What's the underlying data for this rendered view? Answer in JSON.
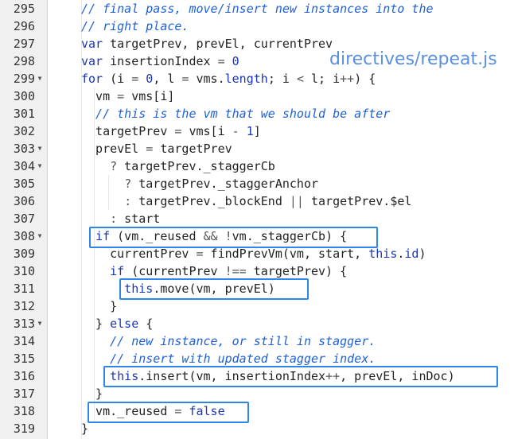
{
  "file_label": "directives/repeat.js",
  "colors": {
    "comment": "#1f5fd6",
    "keyword": "#1a35b5",
    "highlight_box": "#2e86e6",
    "gutter_bg": "#f0f0f0",
    "label": "#5a8fe0"
  },
  "lines": [
    {
      "n": "295",
      "fold": "",
      "segs": [
        [
          "cm",
          "// final pass, move/insert new instances into the"
        ]
      ]
    },
    {
      "n": "296",
      "fold": "",
      "segs": [
        [
          "cm",
          "// right place."
        ]
      ]
    },
    {
      "n": "297",
      "fold": "",
      "segs": [
        [
          "kw",
          "var"
        ],
        [
          "",
          " targetPrev, prevEl, currentPrev"
        ]
      ]
    },
    {
      "n": "298",
      "fold": "",
      "segs": [
        [
          "kw",
          "var"
        ],
        [
          "",
          " insertionIndex "
        ],
        [
          "op",
          "="
        ],
        [
          "",
          " "
        ],
        [
          "num",
          "0"
        ]
      ]
    },
    {
      "n": "299",
      "fold": "▼",
      "segs": [
        [
          "kw",
          "for"
        ],
        [
          "",
          " (i "
        ],
        [
          "op",
          "="
        ],
        [
          "",
          " "
        ],
        [
          "num",
          "0"
        ],
        [
          "",
          ", l "
        ],
        [
          "op",
          "="
        ],
        [
          "",
          " vms."
        ],
        [
          "prop",
          "length"
        ],
        [
          "",
          "; i "
        ],
        [
          "op",
          "<"
        ],
        [
          "",
          " l; i"
        ],
        [
          "op",
          "++"
        ],
        [
          "",
          ") {"
        ]
      ]
    },
    {
      "n": "300",
      "fold": "",
      "segs": [
        [
          "",
          "  vm "
        ],
        [
          "op",
          "="
        ],
        [
          "",
          " vms[i]"
        ]
      ]
    },
    {
      "n": "301",
      "fold": "",
      "segs": [
        [
          "cm",
          "  // this is the vm that we should be after"
        ]
      ]
    },
    {
      "n": "302",
      "fold": "",
      "segs": [
        [
          "",
          "  targetPrev "
        ],
        [
          "op",
          "="
        ],
        [
          "",
          " vms[i "
        ],
        [
          "op",
          "-"
        ],
        [
          "",
          " "
        ],
        [
          "num",
          "1"
        ],
        [
          "",
          "]"
        ]
      ]
    },
    {
      "n": "303",
      "fold": "▼",
      "segs": [
        [
          "",
          "  prevEl "
        ],
        [
          "op",
          "="
        ],
        [
          "",
          " targetPrev"
        ]
      ]
    },
    {
      "n": "304",
      "fold": "▼",
      "segs": [
        [
          "",
          "    "
        ],
        [
          "op",
          "?"
        ],
        [
          "",
          " targetPrev._staggerCb"
        ]
      ]
    },
    {
      "n": "305",
      "fold": "",
      "segs": [
        [
          "",
          "      "
        ],
        [
          "op",
          "?"
        ],
        [
          "",
          " targetPrev._staggerAnchor"
        ]
      ]
    },
    {
      "n": "306",
      "fold": "",
      "segs": [
        [
          "",
          "      "
        ],
        [
          "op",
          ":"
        ],
        [
          "",
          " targetPrev._blockEnd "
        ],
        [
          "op",
          "||"
        ],
        [
          "",
          " targetPrev.$el"
        ]
      ]
    },
    {
      "n": "307",
      "fold": "",
      "segs": [
        [
          "",
          "    "
        ],
        [
          "op",
          ":"
        ],
        [
          "",
          " start"
        ]
      ]
    },
    {
      "n": "308",
      "fold": "▼",
      "segs": [
        [
          "",
          "  "
        ],
        [
          "kw",
          "if"
        ],
        [
          "",
          " (vm._reused "
        ],
        [
          "op",
          "&&"
        ],
        [
          "",
          " "
        ],
        [
          "op",
          "!"
        ],
        [
          "",
          "vm._staggerCb) {"
        ]
      ]
    },
    {
      "n": "309",
      "fold": "",
      "segs": [
        [
          "",
          "    currentPrev "
        ],
        [
          "op",
          "="
        ],
        [
          "",
          " findPrevVm(vm, start, "
        ],
        [
          "kw",
          "this"
        ],
        [
          "",
          "."
        ],
        [
          "prop",
          "id"
        ],
        [
          "",
          ")"
        ]
      ]
    },
    {
      "n": "310",
      "fold": "",
      "segs": [
        [
          "",
          "    "
        ],
        [
          "kw",
          "if"
        ],
        [
          "",
          " (currentPrev "
        ],
        [
          "op",
          "!=="
        ],
        [
          "",
          " targetPrev) {"
        ]
      ]
    },
    {
      "n": "311",
      "fold": "",
      "segs": [
        [
          "",
          "      "
        ],
        [
          "kw",
          "this"
        ],
        [
          "",
          ".move(vm, prevEl)"
        ]
      ]
    },
    {
      "n": "312",
      "fold": "",
      "segs": [
        [
          "",
          "    }"
        ]
      ]
    },
    {
      "n": "313",
      "fold": "▼",
      "segs": [
        [
          "",
          "  } "
        ],
        [
          "kw",
          "else"
        ],
        [
          "",
          " {"
        ]
      ]
    },
    {
      "n": "314",
      "fold": "",
      "segs": [
        [
          "cm",
          "    // new instance, or still in stagger."
        ]
      ]
    },
    {
      "n": "315",
      "fold": "",
      "segs": [
        [
          "cm",
          "    // insert with updated stagger index."
        ]
      ]
    },
    {
      "n": "316",
      "fold": "",
      "segs": [
        [
          "",
          "    "
        ],
        [
          "kw",
          "this"
        ],
        [
          "",
          ".insert(vm, insertionIndex"
        ],
        [
          "op",
          "++"
        ],
        [
          "",
          ", prevEl, inDoc)"
        ]
      ]
    },
    {
      "n": "317",
      "fold": "",
      "segs": [
        [
          "",
          "  }"
        ]
      ]
    },
    {
      "n": "318",
      "fold": "",
      "segs": [
        [
          "",
          "  vm._reused "
        ],
        [
          "op",
          "="
        ],
        [
          "",
          " "
        ],
        [
          "kw",
          "false"
        ]
      ]
    },
    {
      "n": "319",
      "fold": "",
      "segs": [
        [
          "",
          "}"
        ]
      ]
    }
  ]
}
